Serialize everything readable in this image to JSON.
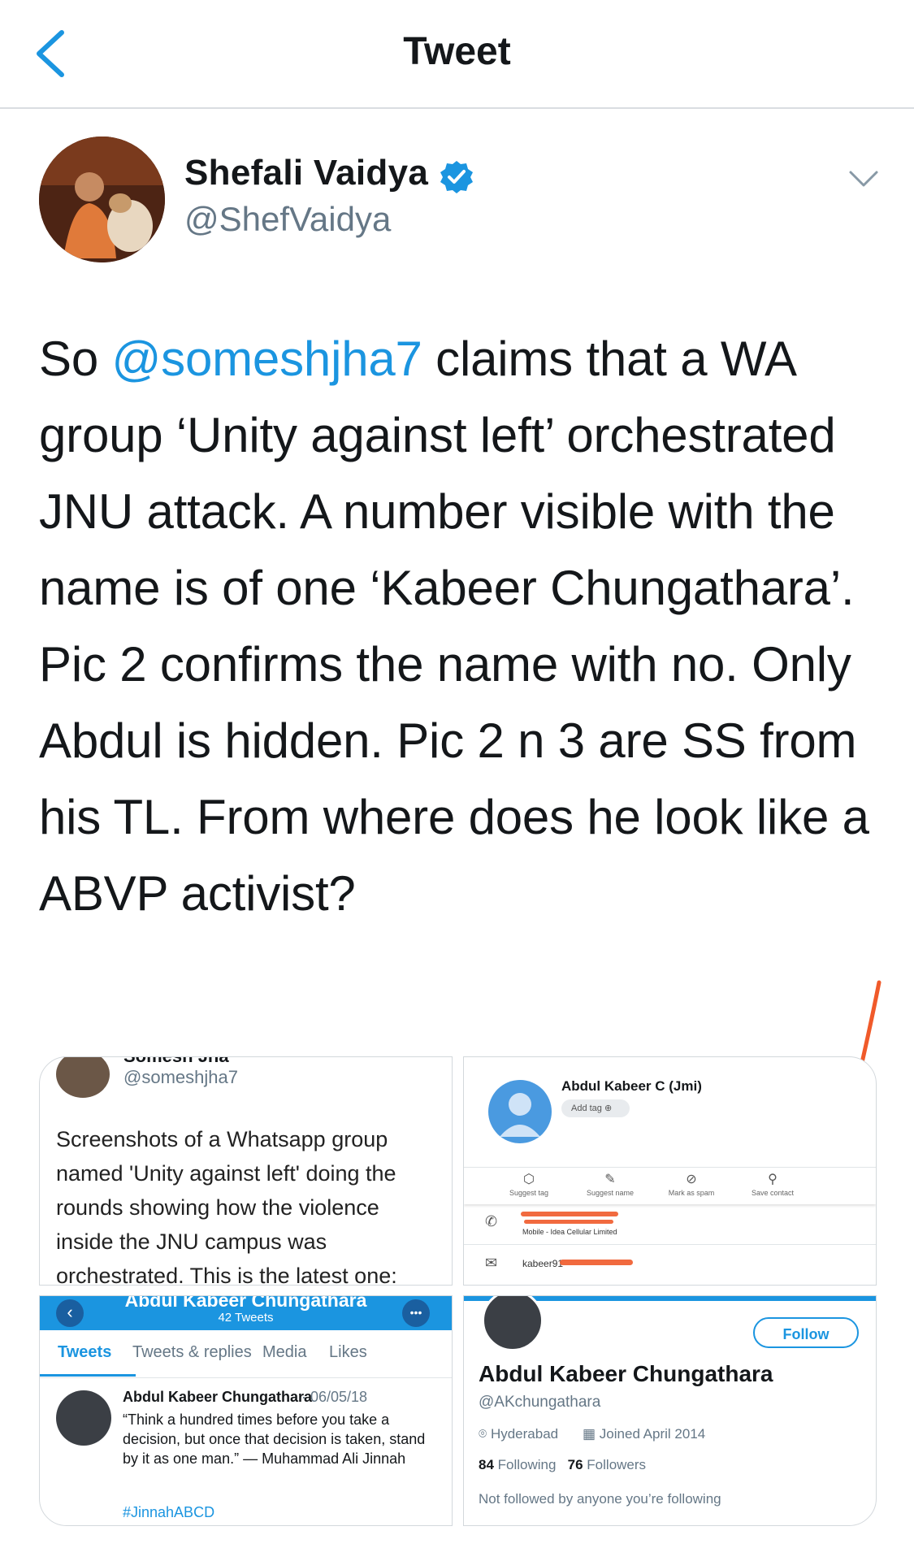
{
  "header": {
    "title": "Tweet",
    "back_icon": "chevron-left-icon"
  },
  "author": {
    "name": "Shefali Vaidya",
    "handle": "@ShefVaidya",
    "verified": true
  },
  "tweet": {
    "text_before": "So ",
    "mention": "@someshjha7",
    "text_after": " claims that a WA group ‘Unity against left’ orchestrated JNU attack. A number visible with the name is of one ‘Kabeer Chungathara’. Pic 2 confirms the name with no. Only Abdul is hidden. Pic 2 n 3 are SS from his TL. From where does he look like a ABVP activist?"
  },
  "media": {
    "pic1": {
      "name": "Somesh Jha",
      "handle": "@someshjha7",
      "text": "Screenshots of a Whatsapp group named 'Unity against left' doing the rounds showing how the violence inside the JNU campus was orchestrated. This is the latest one:"
    },
    "pic2": {
      "contact_name": "Abdul Kabeer C (Jmi)",
      "add_tag": "Add tag",
      "actions": [
        "Suggest tag",
        "Suggest name",
        "Mark as spam",
        "Save contact"
      ],
      "phone_label": "Mobile - Idea Cellular Limited",
      "email_prefix": "kabeer91"
    },
    "pic3": {
      "title": "Abdul Kabeer Chungathara",
      "tweet_count": "42 Tweets",
      "tabs": [
        "Tweets",
        "Tweets & replies",
        "Media",
        "Likes"
      ],
      "author": "Abdul Kabeer Chungathara",
      "date": "· 06/05/18",
      "body": "“Think a hundred times before you take a decision, but once that decision is taken, stand by it as one man.” — Muhammad Ali Jinnah",
      "hashtag": "#JinnahABCD"
    },
    "pic4": {
      "follow": "Follow",
      "name": "Abdul Kabeer Chungathara",
      "handle": "@AKchungathara",
      "location": "Hyderabad",
      "joined": "Joined April 2014",
      "following_count": "84",
      "following_label": "Following",
      "followers_count": "76",
      "followers_label": "Followers",
      "note": "Not followed by anyone you’re following"
    }
  },
  "colors": {
    "accent": "#1b95e0",
    "annotation": "#f05a2a"
  }
}
